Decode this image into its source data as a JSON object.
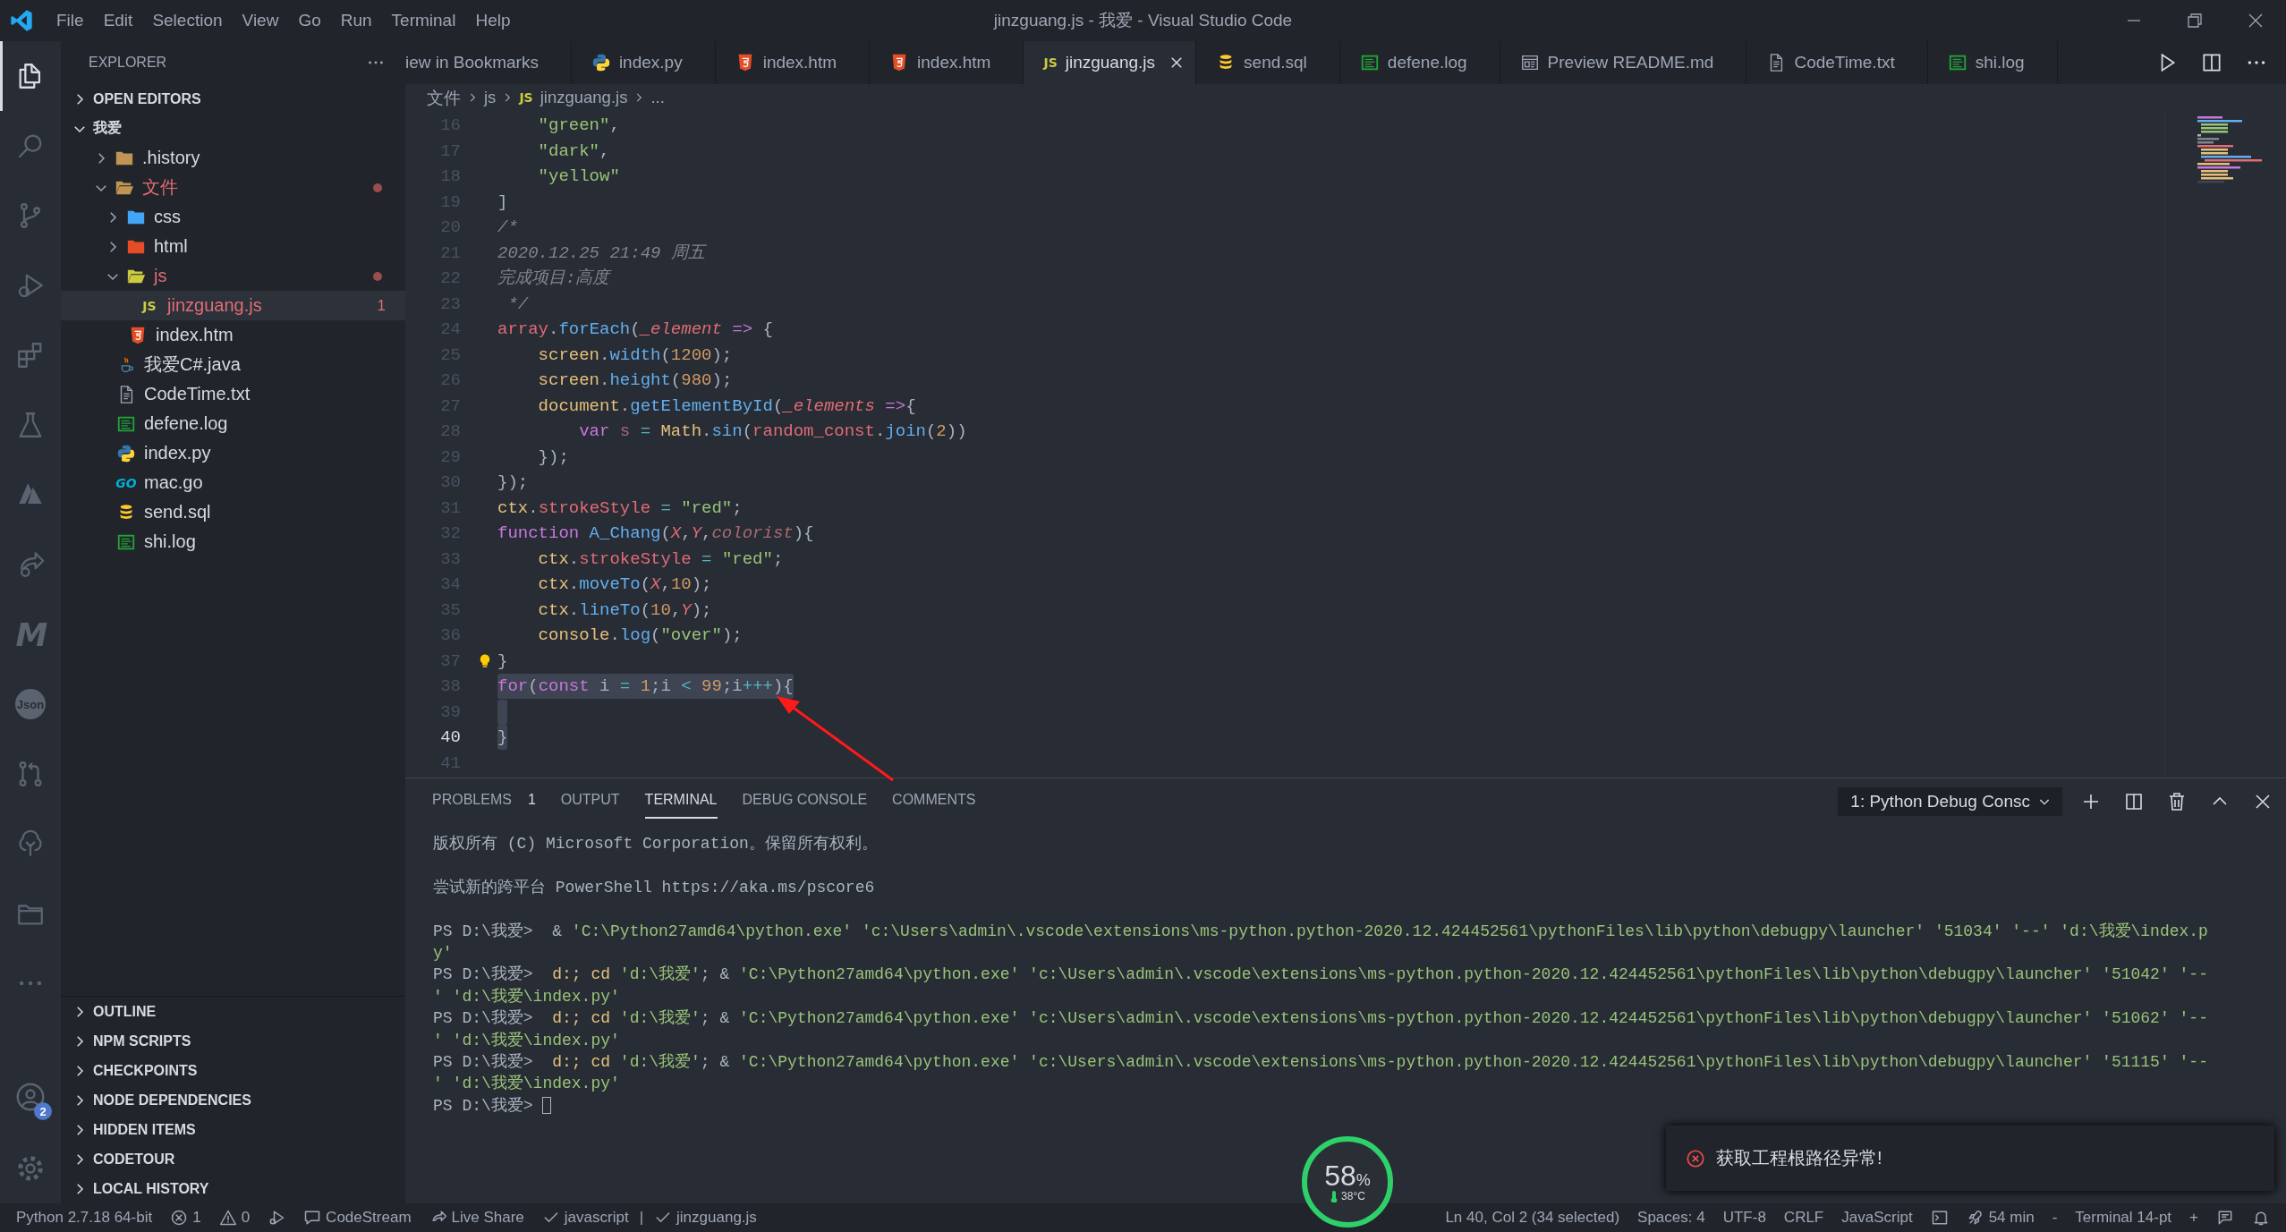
{
  "title_bar": {
    "menu": [
      "File",
      "Edit",
      "Selection",
      "View",
      "Go",
      "Run",
      "Terminal",
      "Help"
    ],
    "title": "jinzguang.js - 我爱 - Visual Studio Code"
  },
  "activity_bar": {
    "items": [
      {
        "kind": "files",
        "selected": true
      },
      {
        "kind": "search",
        "selected": false
      },
      {
        "kind": "branch",
        "selected": false
      },
      {
        "kind": "debug",
        "selected": false
      },
      {
        "kind": "extensions",
        "selected": false
      },
      {
        "kind": "flask",
        "selected": false
      },
      {
        "kind": "azure",
        "selected": false
      },
      {
        "kind": "share",
        "selected": false
      },
      {
        "kind": "letter",
        "label": "M",
        "selected": false
      },
      {
        "kind": "json",
        "label": "Json",
        "selected": false
      },
      {
        "kind": "pr",
        "selected": false
      },
      {
        "kind": "tree",
        "selected": false
      },
      {
        "kind": "folder",
        "selected": false
      },
      {
        "kind": "more",
        "selected": false
      }
    ],
    "account_badge": "2"
  },
  "sidebar": {
    "title": "EXPLORER",
    "sections": [
      {
        "label": "OPEN EDITORS",
        "expanded": false
      },
      {
        "label": "我爱",
        "expanded": true
      }
    ],
    "tree": [
      {
        "name": ".history",
        "kind": "folder",
        "expanded": false,
        "selected": false,
        "error": false
      },
      {
        "name": "文件",
        "kind": "folder",
        "expanded": true,
        "selected": false,
        "error": true,
        "children": [
          {
            "name": "css",
            "kind": "folder-css",
            "expanded": false,
            "selected": false,
            "error": false
          },
          {
            "name": "html",
            "kind": "folder-html",
            "expanded": false,
            "selected": false,
            "error": false
          },
          {
            "name": "js",
            "kind": "folder-js",
            "expanded": true,
            "selected": false,
            "error": true,
            "children": [
              {
                "name": "jinzguang.js",
                "kind": "js",
                "icon_text": "JS",
                "selected": true,
                "error": true,
                "badge": "1"
              }
            ]
          },
          {
            "name": "index.htm",
            "kind": "html",
            "selected": false,
            "error": false
          }
        ]
      },
      {
        "name": "我爱C#.java",
        "kind": "java",
        "selected": false,
        "error": false
      },
      {
        "name": "CodeTime.txt",
        "kind": "txt",
        "selected": false,
        "error": false
      },
      {
        "name": "defene.log",
        "kind": "log",
        "selected": false,
        "error": false
      },
      {
        "name": "index.py",
        "kind": "python",
        "selected": false,
        "error": false
      },
      {
        "name": "mac.go",
        "kind": "go",
        "icon_text": "GO",
        "selected": false,
        "error": false
      },
      {
        "name": "send.sql",
        "kind": "sql",
        "selected": false,
        "error": false
      },
      {
        "name": "shi.log",
        "kind": "log",
        "selected": false,
        "error": false
      }
    ],
    "bottom_sections": [
      {
        "label": "OUTLINE",
        "expanded": false
      },
      {
        "label": "NPM SCRIPTS",
        "expanded": false
      },
      {
        "label": "CHECKPOINTS",
        "expanded": false
      },
      {
        "label": "NODE DEPENDENCIES",
        "expanded": false
      },
      {
        "label": "HIDDEN ITEMS",
        "expanded": false
      },
      {
        "label": "CODETOUR",
        "expanded": false
      },
      {
        "label": "LOCAL HISTORY",
        "expanded": false
      }
    ]
  },
  "tabs": [
    {
      "label": "iew in Bookmarks",
      "kind": "none",
      "selected": false
    },
    {
      "label": "index.py",
      "kind": "python",
      "selected": false
    },
    {
      "label": "index.htm",
      "kind": "html",
      "selected": false
    },
    {
      "label": "index.htm",
      "kind": "html",
      "selected": false
    },
    {
      "label": "jinzguang.js",
      "kind": "js",
      "icon_text": "JS",
      "selected": true
    },
    {
      "label": "send.sql",
      "kind": "sql",
      "selected": false
    },
    {
      "label": "defene.log",
      "kind": "log",
      "selected": false
    },
    {
      "label": "Preview README.md",
      "kind": "preview",
      "selected": false
    },
    {
      "label": "CodeTime.txt",
      "kind": "txt",
      "selected": false
    },
    {
      "label": "shi.log",
      "kind": "log",
      "selected": false
    }
  ],
  "breadcrumb": [
    {
      "label": "文件"
    },
    {
      "label": "js"
    },
    {
      "label": "jinzguang.js",
      "kind": "js",
      "icon_text": "JS"
    },
    {
      "label": "..."
    }
  ],
  "editor": {
    "lines": [
      {
        "number": "16",
        "selected": false,
        "current": false,
        "tokens": [
          {
            "text": "    \"green\"",
            "kind": "str"
          },
          {
            "text": ",",
            "kind": "plain"
          }
        ]
      },
      {
        "number": "17",
        "selected": false,
        "current": false,
        "tokens": [
          {
            "text": "    \"dark\"",
            "kind": "str"
          },
          {
            "text": ",",
            "kind": "plain"
          }
        ]
      },
      {
        "number": "18",
        "selected": false,
        "current": false,
        "tokens": [
          {
            "text": "    \"yellow\"",
            "kind": "str"
          }
        ]
      },
      {
        "number": "19",
        "selected": false,
        "current": false,
        "tokens": [
          {
            "text": "]",
            "kind": "plain"
          }
        ]
      },
      {
        "number": "20",
        "selected": false,
        "current": false,
        "tokens": [
          {
            "text": "/*",
            "kind": "cmt"
          }
        ]
      },
      {
        "number": "21",
        "selected": false,
        "current": false,
        "tokens": [
          {
            "text": "2020.12.25 21:49 周五",
            "kind": "cmt"
          }
        ]
      },
      {
        "number": "22",
        "selected": false,
        "current": false,
        "tokens": [
          {
            "text": "完成项目:高度",
            "kind": "cmt"
          }
        ]
      },
      {
        "number": "23",
        "selected": false,
        "current": false,
        "tokens": [
          {
            "text": " */",
            "kind": "cmt"
          }
        ]
      },
      {
        "number": "24",
        "selected": false,
        "current": false,
        "tokens": [
          {
            "text": "array",
            "kind": "var"
          },
          {
            "text": ".",
            "kind": "plain"
          },
          {
            "text": "forEach",
            "kind": "fn"
          },
          {
            "text": "(",
            "kind": "plain"
          },
          {
            "text": "_element",
            "kind": "param"
          },
          {
            "text": " =>",
            "kind": "kw"
          },
          {
            "text": " {",
            "kind": "plain"
          }
        ]
      },
      {
        "number": "25",
        "selected": false,
        "current": false,
        "tokens": [
          {
            "text": "    screen",
            "kind": "cls"
          },
          {
            "text": ".",
            "kind": "plain"
          },
          {
            "text": "width",
            "kind": "fn"
          },
          {
            "text": "(",
            "kind": "plain"
          },
          {
            "text": "1200",
            "kind": "num"
          },
          {
            "text": ");",
            "kind": "plain"
          }
        ]
      },
      {
        "number": "26",
        "selected": false,
        "current": false,
        "tokens": [
          {
            "text": "    screen",
            "kind": "cls"
          },
          {
            "text": ".",
            "kind": "plain"
          },
          {
            "text": "height",
            "kind": "fn"
          },
          {
            "text": "(",
            "kind": "plain"
          },
          {
            "text": "980",
            "kind": "num"
          },
          {
            "text": ");",
            "kind": "plain"
          }
        ]
      },
      {
        "number": "27",
        "selected": false,
        "current": false,
        "tokens": [
          {
            "text": "    document",
            "kind": "cls"
          },
          {
            "text": ".",
            "kind": "plain"
          },
          {
            "text": "getElementById",
            "kind": "fn"
          },
          {
            "text": "(",
            "kind": "plain"
          },
          {
            "text": "_elements",
            "kind": "param"
          },
          {
            "text": " =>",
            "kind": "kw"
          },
          {
            "text": "{",
            "kind": "plain"
          }
        ]
      },
      {
        "number": "28",
        "selected": false,
        "current": false,
        "tokens": [
          {
            "text": "        var",
            "kind": "kw"
          },
          {
            "text": " s",
            "kind": "unused"
          },
          {
            "text": " = ",
            "kind": "op"
          },
          {
            "text": "Math",
            "kind": "cls"
          },
          {
            "text": ".",
            "kind": "plain"
          },
          {
            "text": "sin",
            "kind": "fn"
          },
          {
            "text": "(",
            "kind": "plain"
          },
          {
            "text": "random_const",
            "kind": "var"
          },
          {
            "text": ".",
            "kind": "plain"
          },
          {
            "text": "join",
            "kind": "fn"
          },
          {
            "text": "(",
            "kind": "plain"
          },
          {
            "text": "2",
            "kind": "num"
          },
          {
            "text": "))",
            "kind": "plain"
          }
        ]
      },
      {
        "number": "29",
        "selected": false,
        "current": false,
        "tokens": [
          {
            "text": "    });",
            "kind": "plain"
          }
        ]
      },
      {
        "number": "30",
        "selected": false,
        "current": false,
        "tokens": [
          {
            "text": "});",
            "kind": "plain"
          }
        ]
      },
      {
        "number": "31",
        "selected": false,
        "current": false,
        "tokens": [
          {
            "text": "ctx",
            "kind": "cls"
          },
          {
            "text": ".",
            "kind": "plain"
          },
          {
            "text": "strokeStyle",
            "kind": "var"
          },
          {
            "text": " = ",
            "kind": "op"
          },
          {
            "text": "\"red\"",
            "kind": "str"
          },
          {
            "text": ";",
            "kind": "plain"
          }
        ]
      },
      {
        "number": "32",
        "selected": false,
        "current": false,
        "tokens": [
          {
            "text": "function",
            "kind": "kw"
          },
          {
            "text": " A_Chang",
            "kind": "fn"
          },
          {
            "text": "(",
            "kind": "plain"
          },
          {
            "text": "X",
            "kind": "param"
          },
          {
            "text": ",",
            "kind": "plain"
          },
          {
            "text": "Y",
            "kind": "param"
          },
          {
            "text": ",",
            "kind": "plain"
          },
          {
            "text": "colorist",
            "kind": "uparam"
          },
          {
            "text": "){",
            "kind": "plain"
          }
        ]
      },
      {
        "number": "33",
        "selected": false,
        "current": false,
        "tokens": [
          {
            "text": "    ctx",
            "kind": "cls"
          },
          {
            "text": ".",
            "kind": "plain"
          },
          {
            "text": "strokeStyle",
            "kind": "var"
          },
          {
            "text": " = ",
            "kind": "op"
          },
          {
            "text": "\"red\"",
            "kind": "str"
          },
          {
            "text": ";",
            "kind": "plain"
          }
        ]
      },
      {
        "number": "34",
        "selected": false,
        "current": false,
        "tokens": [
          {
            "text": "    ctx",
            "kind": "cls"
          },
          {
            "text": ".",
            "kind": "plain"
          },
          {
            "text": "moveTo",
            "kind": "fn"
          },
          {
            "text": "(",
            "kind": "plain"
          },
          {
            "text": "X",
            "kind": "param"
          },
          {
            "text": ",",
            "kind": "plain"
          },
          {
            "text": "10",
            "kind": "num"
          },
          {
            "text": ");",
            "kind": "plain"
          }
        ]
      },
      {
        "number": "35",
        "selected": false,
        "current": false,
        "tokens": [
          {
            "text": "    ctx",
            "kind": "cls"
          },
          {
            "text": ".",
            "kind": "plain"
          },
          {
            "text": "lineTo",
            "kind": "fn"
          },
          {
            "text": "(",
            "kind": "plain"
          },
          {
            "text": "10",
            "kind": "num"
          },
          {
            "text": ",",
            "kind": "plain"
          },
          {
            "text": "Y",
            "kind": "param"
          },
          {
            "text": ");",
            "kind": "plain"
          }
        ]
      },
      {
        "number": "36",
        "selected": false,
        "current": false,
        "tokens": [
          {
            "text": "    console",
            "kind": "cls"
          },
          {
            "text": ".",
            "kind": "plain"
          },
          {
            "text": "log",
            "kind": "fn"
          },
          {
            "text": "(",
            "kind": "plain"
          },
          {
            "text": "\"over\"",
            "kind": "str"
          },
          {
            "text": ");",
            "kind": "plain"
          }
        ]
      },
      {
        "number": "37",
        "selected": false,
        "current": false,
        "tokens": [
          {
            "kind": "bulb"
          },
          {
            "text": "}",
            "kind": "plain"
          }
        ]
      },
      {
        "number": "38",
        "selected": true,
        "current": false,
        "tokens": [
          {
            "text": "for",
            "kind": "kw"
          },
          {
            "text": "(",
            "kind": "plain"
          },
          {
            "text": "const",
            "kind": "kw"
          },
          {
            "text": " i",
            "kind": "plain"
          },
          {
            "text": " = ",
            "kind": "op"
          },
          {
            "text": "1",
            "kind": "num"
          },
          {
            "text": ";i",
            "kind": "plain"
          },
          {
            "text": " < ",
            "kind": "op"
          },
          {
            "text": "99",
            "kind": "num"
          },
          {
            "text": ";i",
            "kind": "plain"
          },
          {
            "text": "+++",
            "kind": "op"
          },
          {
            "text": "){",
            "kind": "plain"
          }
        ]
      },
      {
        "number": "39",
        "selected": true,
        "current": false
      },
      {
        "number": "40",
        "selected": true,
        "current": true,
        "tokens": [
          {
            "text": "}",
            "kind": "plain"
          }
        ]
      },
      {
        "number": "41",
        "selected": false,
        "current": false
      }
    ]
  },
  "panel": {
    "tabs": [
      {
        "label": "PROBLEMS",
        "badge": "1",
        "selected": false
      },
      {
        "label": "OUTPUT",
        "selected": false
      },
      {
        "label": "TERMINAL",
        "selected": true
      },
      {
        "label": "DEBUG CONSOLE",
        "selected": false
      },
      {
        "label": "COMMENTS",
        "selected": false
      }
    ],
    "terminal_picker": "1: Python Debug Consc",
    "blocks": [
      [
        [
          {
            "text": "版权所有 (C) Microsoft Corporation。保留所有权利。",
            "kind": "plain"
          }
        ]
      ],
      [
        [
          {
            "text": "尝试新的跨平台 PowerShell https://aka.ms/pscore6",
            "kind": "plain"
          }
        ]
      ],
      [
        [
          {
            "text": "PS D:\\我爱>  & ",
            "kind": "plain"
          },
          {
            "text": "'C:\\Python27amd64\\python.exe' 'c:\\Users\\admin\\.vscode\\extensions\\ms-python.python-2020.12.424452561\\pythonFiles\\lib\\python\\debugpy\\launcher' '51034' '--' 'd:\\我爱\\index.p",
            "kind": "str"
          }
        ],
        [
          {
            "text": "y'",
            "kind": "str"
          }
        ],
        [
          {
            "text": "PS D:\\我爱>  ",
            "kind": "plain"
          },
          {
            "text": "d:; cd",
            "kind": "cmd"
          },
          {
            "text": " 'd:\\我爱'",
            "kind": "str"
          },
          {
            "text": "; & ",
            "kind": "plain"
          },
          {
            "text": "'C:\\Python27amd64\\python.exe' 'c:\\Users\\admin\\.vscode\\extensions\\ms-python.python-2020.12.424452561\\pythonFiles\\lib\\python\\debugpy\\launcher' '51042' '--",
            "kind": "str"
          }
        ],
        [
          {
            "text": "' 'd:\\我爱\\index.py'",
            "kind": "str"
          }
        ],
        [
          {
            "text": "PS D:\\我爱>  ",
            "kind": "plain"
          },
          {
            "text": "d:; cd",
            "kind": "cmd"
          },
          {
            "text": " 'd:\\我爱'",
            "kind": "str"
          },
          {
            "text": "; & ",
            "kind": "plain"
          },
          {
            "text": "'C:\\Python27amd64\\python.exe' 'c:\\Users\\admin\\.vscode\\extensions\\ms-python.python-2020.12.424452561\\pythonFiles\\lib\\python\\debugpy\\launcher' '51062' '--",
            "kind": "str"
          }
        ],
        [
          {
            "text": "' 'd:\\我爱\\index.py'",
            "kind": "str"
          }
        ],
        [
          {
            "text": "PS D:\\我爱>  ",
            "kind": "plain"
          },
          {
            "text": "d:; cd",
            "kind": "cmd"
          },
          {
            "text": " 'd:\\我爱'",
            "kind": "str"
          },
          {
            "text": "; & ",
            "kind": "plain"
          },
          {
            "text": "'C:\\Python27amd64\\python.exe' 'c:\\Users\\admin\\.vscode\\extensions\\ms-python.python-2020.12.424452561\\pythonFiles\\lib\\python\\debugpy\\launcher' '51115' '--",
            "kind": "str"
          }
        ],
        [
          {
            "text": "' 'd:\\我爱\\index.py'",
            "kind": "str"
          }
        ],
        [
          {
            "text": "PS D:\\我爱> ",
            "kind": "plain"
          },
          {
            "kind": "cursor"
          }
        ]
      ]
    ]
  },
  "notification": {
    "kind": "error",
    "message": "获取工程根路径异常!"
  },
  "gauge": {
    "value": "58",
    "unit": "%",
    "temperature": "38°C"
  },
  "status_bar": {
    "left": [
      {
        "label": "Python 2.7.18 64-bit"
      },
      {
        "kind": "error",
        "label": "1"
      },
      {
        "kind": "warning",
        "label": "0"
      },
      {
        "kind": "debug"
      },
      {
        "kind": "comment",
        "label": "CodeStream"
      },
      {
        "kind": "share",
        "label": "Live Share"
      },
      {
        "kind": "check",
        "label": "javascript"
      },
      {
        "kind": "separator",
        "label": "|"
      },
      {
        "kind": "check",
        "label": "jinzguang.js"
      }
    ],
    "right": [
      {
        "label": "Ln 40, Col 2 (34 selected)"
      },
      {
        "label": "Spaces: 4"
      },
      {
        "label": "UTF-8"
      },
      {
        "label": "CRLF"
      },
      {
        "label": "JavaScript"
      },
      {
        "kind": "terminal"
      },
      {
        "kind": "rocket",
        "label": "54 min"
      },
      {
        "label": "-"
      },
      {
        "label": "Terminal 14-pt"
      },
      {
        "label": "+"
      },
      {
        "kind": "feedback"
      },
      {
        "kind": "bell"
      }
    ]
  }
}
